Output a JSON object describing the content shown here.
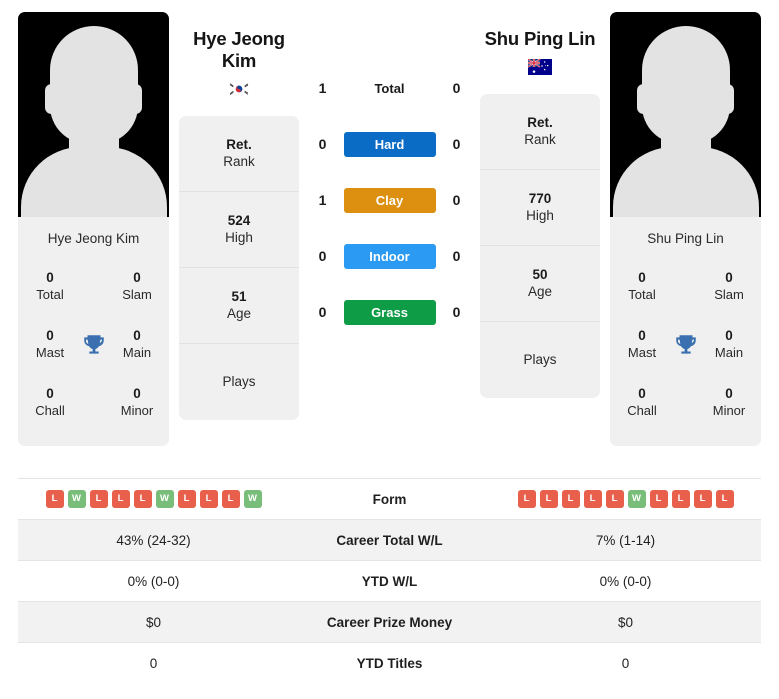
{
  "players": {
    "left": {
      "name": "Hye Jeong Kim",
      "name_line1": "Hye Jeong",
      "name_line2": "Kim",
      "photo_caption": "Hye Jeong Kim",
      "flag": "south-korea-flag",
      "titles": [
        {
          "num": "0",
          "label": "Total"
        },
        {
          "num": "0",
          "label": "Slam"
        },
        {
          "num": "0",
          "label": "Mast"
        },
        {
          "num": "0",
          "label": "Main"
        },
        {
          "num": "0",
          "label": "Chall"
        },
        {
          "num": "0",
          "label": "Minor"
        }
      ],
      "info": [
        {
          "value": "Ret.",
          "label": "Rank"
        },
        {
          "value": "524",
          "label": "High"
        },
        {
          "value": "51",
          "label": "Age"
        },
        {
          "value": "",
          "label": "Plays"
        }
      ],
      "form": [
        "L",
        "W",
        "L",
        "L",
        "L",
        "W",
        "L",
        "L",
        "L",
        "W"
      ]
    },
    "right": {
      "name": "Shu Ping Lin",
      "name_line1": "Shu Ping Lin",
      "name_line2": "",
      "photo_caption": "Shu Ping Lin",
      "flag": "australia-flag",
      "titles": [
        {
          "num": "0",
          "label": "Total"
        },
        {
          "num": "0",
          "label": "Slam"
        },
        {
          "num": "0",
          "label": "Mast"
        },
        {
          "num": "0",
          "label": "Main"
        },
        {
          "num": "0",
          "label": "Chall"
        },
        {
          "num": "0",
          "label": "Minor"
        }
      ],
      "info": [
        {
          "value": "Ret.",
          "label": "Rank"
        },
        {
          "value": "770",
          "label": "High"
        },
        {
          "value": "50",
          "label": "Age"
        },
        {
          "value": "",
          "label": "Plays"
        }
      ],
      "form": [
        "L",
        "L",
        "L",
        "L",
        "L",
        "W",
        "L",
        "L",
        "L",
        "L"
      ]
    }
  },
  "h2h": [
    {
      "label": "Total",
      "left": "1",
      "right": "0",
      "color": ""
    },
    {
      "label": "Hard",
      "left": "0",
      "right": "0",
      "color": "#0a6cc4"
    },
    {
      "label": "Clay",
      "left": "1",
      "right": "0",
      "color": "#dd9010"
    },
    {
      "label": "Indoor",
      "left": "0",
      "right": "0",
      "color": "#2b9af3"
    },
    {
      "label": "Grass",
      "left": "0",
      "right": "0",
      "color": "#0e9c47"
    }
  ],
  "stats_rows": [
    {
      "label": "Form",
      "left": "",
      "right": "",
      "type": "form"
    },
    {
      "label": "Career Total W/L",
      "left": "43% (24-32)",
      "right": "7% (1-14)",
      "type": "text"
    },
    {
      "label": "YTD W/L",
      "left": "0% (0-0)",
      "right": "0% (0-0)",
      "type": "text"
    },
    {
      "label": "Career Prize Money",
      "left": "$0",
      "right": "$0",
      "type": "text"
    },
    {
      "label": "YTD Titles",
      "left": "0",
      "right": "0",
      "type": "text"
    }
  ],
  "colors": {
    "win": "#79bd7a",
    "loss": "#e8604c",
    "trophy": "#3a6fb0",
    "panel": "#f0f0f0",
    "alt_row": "#f2f2f2"
  }
}
